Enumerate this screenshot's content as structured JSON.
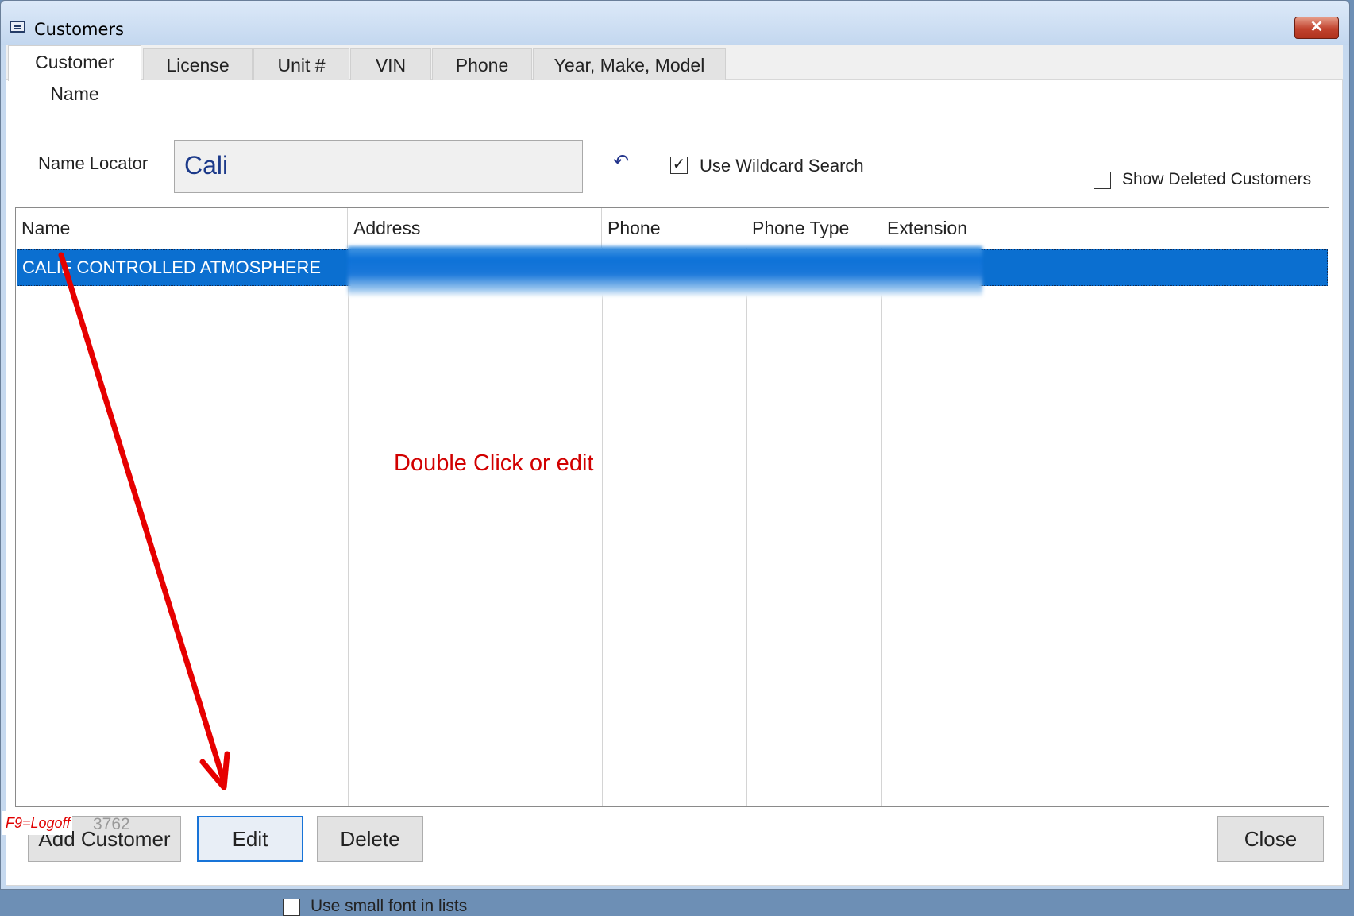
{
  "window": {
    "title": "Customers",
    "close_glyph": "✕"
  },
  "tabs": [
    {
      "label": "Customer Name",
      "active": true
    },
    {
      "label": "License",
      "active": false
    },
    {
      "label": "Unit #",
      "active": false
    },
    {
      "label": "VIN",
      "active": false
    },
    {
      "label": "Phone",
      "active": false
    },
    {
      "label": "Year, Make, Model",
      "active": false
    }
  ],
  "search": {
    "label": "Name Locator",
    "value": "Cali",
    "undo_icon": "undo-icon",
    "wildcard_label": "Use Wildcard Search",
    "wildcard_checked": true,
    "show_deleted_label": "Show Deleted Customers",
    "show_deleted_checked": false
  },
  "grid": {
    "columns": [
      "Name",
      "Address",
      "Phone",
      "Phone Type",
      "Extension"
    ],
    "rows": [
      {
        "name": "CALIF CONTROLLED ATMOSPHERE",
        "selected": true
      }
    ]
  },
  "annotation": {
    "text": "Double Click or edit",
    "color": "#d10000"
  },
  "buttons": {
    "add": "Add Customer",
    "edit": "Edit",
    "delete": "Delete",
    "close": "Close"
  },
  "footer": {
    "logoff": "F9=Logoff",
    "code": "3762",
    "small_font_label": "Use small font in lists",
    "small_font_checked": false
  },
  "colors": {
    "selection": "#0b6fd0",
    "accent": "#1874d8",
    "alert": "#e00000"
  }
}
